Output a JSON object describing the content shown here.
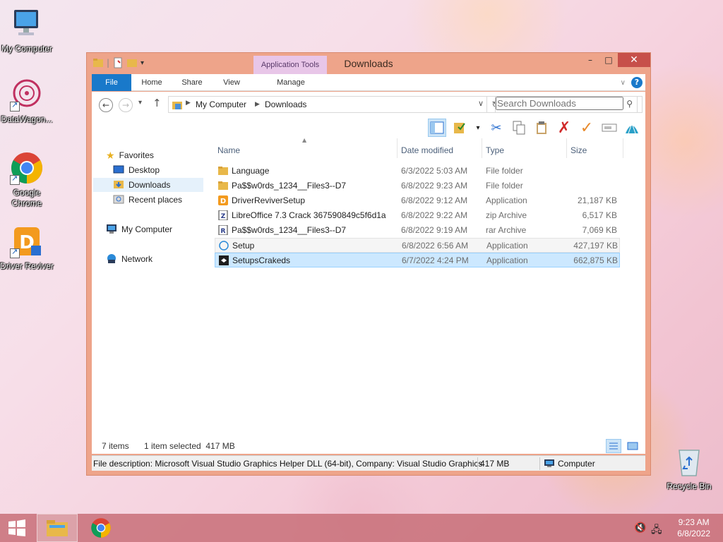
{
  "desktop": {
    "icons": [
      {
        "label": "My Computer",
        "icon": "monitor-icon"
      },
      {
        "label": "DataWagon...",
        "icon": "datawagon-icon"
      },
      {
        "label": "Google Chrome",
        "icon": "chrome-icon"
      },
      {
        "label": "Driver Reviver",
        "icon": "driver-reviver-icon"
      },
      {
        "label": "Recycle Bin",
        "icon": "recycle-bin-icon"
      }
    ]
  },
  "window": {
    "title": "Downloads",
    "context_tab": "Application Tools",
    "caption": {
      "minimize": "–",
      "maximize": "□",
      "close": "✕"
    }
  },
  "ribbon": {
    "tabs": [
      {
        "label": "File"
      },
      {
        "label": "Home"
      },
      {
        "label": "Share"
      },
      {
        "label": "View"
      },
      {
        "label": "Manage"
      }
    ],
    "help": "?"
  },
  "address": {
    "crumbs": [
      "My Computer",
      "Downloads"
    ],
    "search_placeholder": "Search Downloads"
  },
  "nav": {
    "favorites": "Favorites",
    "items": [
      "Desktop",
      "Downloads",
      "Recent places"
    ],
    "computer": "My Computer",
    "network": "Network",
    "selected": "Downloads"
  },
  "columns": [
    "Name",
    "Date modified",
    "Type",
    "Size"
  ],
  "files": [
    {
      "name": "Language",
      "date": "6/3/2022 5:03 AM",
      "type": "File folder",
      "size": "",
      "icon": "folder-icon"
    },
    {
      "name": "Pa$$w0rds_1234__Files3--D7",
      "date": "6/8/2022 9:23 AM",
      "type": "File folder",
      "size": "",
      "icon": "folder-icon"
    },
    {
      "name": "DriverReviverSetup",
      "date": "6/8/2022 9:12 AM",
      "type": "Application",
      "size": "21,187 KB",
      "icon": "driver-reviver-icon"
    },
    {
      "name": "LibreOffice 7.3 Crack 367590849c5f6d1a",
      "date": "6/8/2022 9:22 AM",
      "type": "zip Archive",
      "size": "6,517 KB",
      "icon": "zip-icon"
    },
    {
      "name": "Pa$$w0rds_1234__Files3--D7",
      "date": "6/8/2022 9:19 AM",
      "type": "rar Archive",
      "size": "7,069 KB",
      "icon": "rar-icon"
    },
    {
      "name": "Setup",
      "date": "6/8/2022 6:56 AM",
      "type": "Application",
      "size": "427,197 KB",
      "icon": "setup-icon"
    },
    {
      "name": "SetupsCrakeds",
      "date": "6/7/2022 4:24 PM",
      "type": "Application",
      "size": "662,875 KB",
      "icon": "visual-studio-icon"
    }
  ],
  "selected_row": "SetupsCrakeds",
  "status": {
    "items": "7 items",
    "selection": "1 item selected  417 MB"
  },
  "description": {
    "text": "File description: Microsoft Visual Studio Graphics Helper DLL (64-bit), Company: Visual Studio Graphics",
    "size": "417 MB",
    "location": "Computer"
  },
  "taskbar": {
    "time": "9:23 AM",
    "date": "6/8/2022"
  },
  "colors": {
    "window_frame": "#eea48a",
    "file_tab": "#1979ca",
    "context_tab": "#e8c6e8",
    "selection": "#cce8ff",
    "taskbar": "#c86e78"
  }
}
